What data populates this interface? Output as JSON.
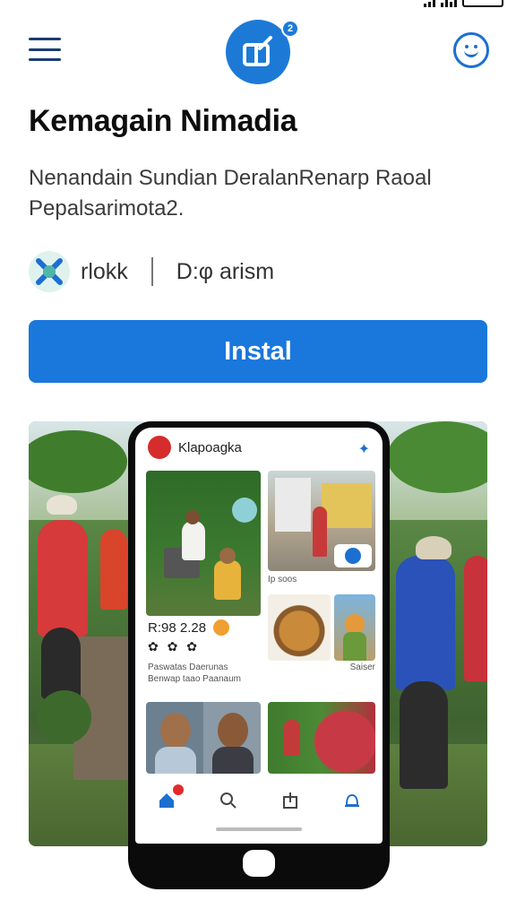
{
  "colors": {
    "accent": "#1a77dc",
    "nav_icon": "#1b3c73",
    "install_text": "#ffffff"
  },
  "header": {
    "logo_badge": "2"
  },
  "app": {
    "title": "Kemagain Nimadia",
    "description_line1": "Nenandain Sundian DeralanRenarp Raoal",
    "description_line2": "Pepalsarimota2.",
    "developer": "rlokk",
    "meta_info": "D:φ arism"
  },
  "install": {
    "label": "Instal"
  },
  "phone_screen": {
    "app_name": "Klapoagka",
    "post_count": "R:98 2.28",
    "caption_small_1": "Ip soos",
    "caption_small_2": "Saiser",
    "post_text_line1": "Paswatas Daerunas",
    "post_text_line2": "Benwap taao Paanaum"
  },
  "icons": [
    "menu-icon",
    "app-logo-icon",
    "face-icon",
    "developer-icon",
    "home-icon",
    "search-icon",
    "share-icon",
    "bell-icon"
  ]
}
